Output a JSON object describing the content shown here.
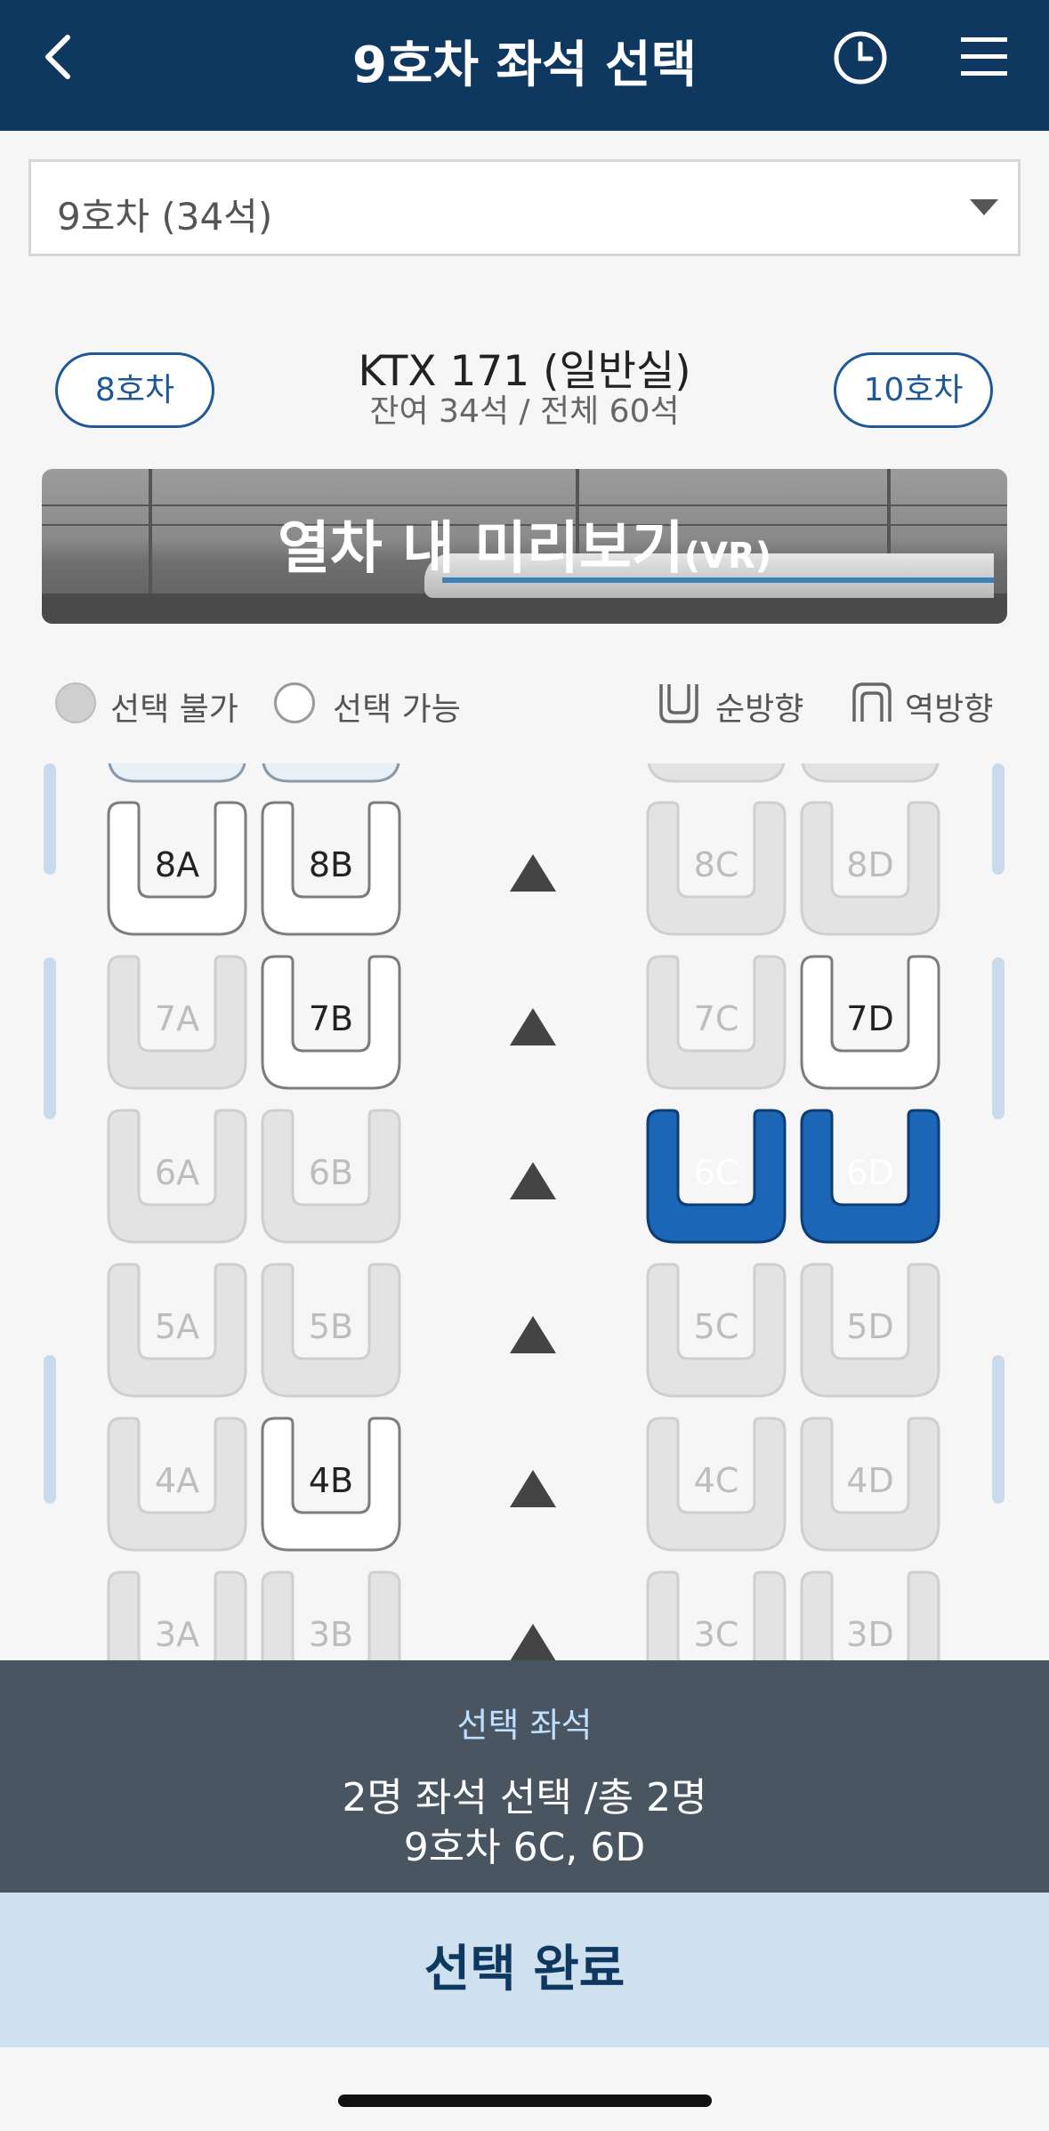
{
  "header": {
    "title": "9호차 좌석 선택"
  },
  "car_select": {
    "value": "9호차 (34석)"
  },
  "nav": {
    "prev_car": "8호차",
    "next_car": "10호차"
  },
  "train": {
    "name": "KTX 171 (일반실)",
    "seats": "잔여 34석 / 전체 60석"
  },
  "vr_banner": {
    "label": "열차 내 미리보기",
    "suffix": "(VR)"
  },
  "legend": {
    "unavailable": "선택 불가",
    "available": "선택 가능",
    "forward": "순방향",
    "backward": "역방향"
  },
  "seat_rows": [
    {
      "row": "8",
      "seats": [
        {
          "label": "8A",
          "status": "available"
        },
        {
          "label": "8B",
          "status": "available"
        },
        {
          "label": "8C",
          "status": "unavailable"
        },
        {
          "label": "8D",
          "status": "unavailable"
        }
      ]
    },
    {
      "row": "7",
      "seats": [
        {
          "label": "7A",
          "status": "unavailable"
        },
        {
          "label": "7B",
          "status": "available"
        },
        {
          "label": "7C",
          "status": "unavailable"
        },
        {
          "label": "7D",
          "status": "available"
        }
      ]
    },
    {
      "row": "6",
      "seats": [
        {
          "label": "6A",
          "status": "unavailable"
        },
        {
          "label": "6B",
          "status": "unavailable"
        },
        {
          "label": "6C",
          "status": "selected"
        },
        {
          "label": "6D",
          "status": "selected"
        }
      ]
    },
    {
      "row": "5",
      "seats": [
        {
          "label": "5A",
          "status": "unavailable"
        },
        {
          "label": "5B",
          "status": "unavailable"
        },
        {
          "label": "5C",
          "status": "unavailable"
        },
        {
          "label": "5D",
          "status": "unavailable"
        }
      ]
    },
    {
      "row": "4",
      "seats": [
        {
          "label": "4A",
          "status": "unavailable"
        },
        {
          "label": "4B",
          "status": "available"
        },
        {
          "label": "4C",
          "status": "unavailable"
        },
        {
          "label": "4D",
          "status": "unavailable"
        }
      ]
    },
    {
      "row": "3",
      "seats": [
        {
          "label": "3A",
          "status": "unavailable"
        },
        {
          "label": "3B",
          "status": "unavailable"
        },
        {
          "label": "3C",
          "status": "unavailable"
        },
        {
          "label": "3D",
          "status": "unavailable"
        }
      ]
    }
  ],
  "selection_panel": {
    "title": "선택 좌석",
    "count": "2명 좌석 선택 /총 2명",
    "seats": "9호차 6C, 6D"
  },
  "complete_button": "선택 완료",
  "colors": {
    "header": "#0f3861",
    "selected_seat": "#1c66b8",
    "accent_blue": "#1f5896"
  }
}
